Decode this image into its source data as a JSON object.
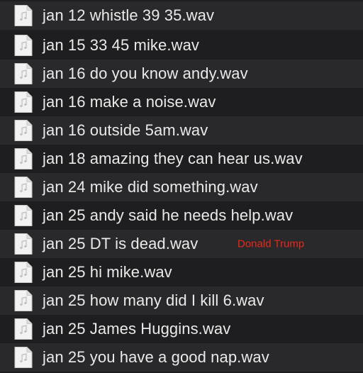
{
  "files": [
    {
      "name": "jan 12 whistle 39 35.wav",
      "icon": "audio-file-icon"
    },
    {
      "name": "jan 15 33 45 mike.wav",
      "icon": "audio-file-icon"
    },
    {
      "name": "jan 16 do you know andy.wav",
      "icon": "audio-file-icon"
    },
    {
      "name": "jan 16 make a noise.wav",
      "icon": "audio-file-icon"
    },
    {
      "name": "jan 16 outside 5am.wav",
      "icon": "audio-file-icon"
    },
    {
      "name": "jan 18 amazing they can hear us.wav",
      "icon": "audio-file-icon"
    },
    {
      "name": "jan 24 mike did something.wav",
      "icon": "audio-file-icon"
    },
    {
      "name": "jan 25 andy said he needs help.wav",
      "icon": "audio-file-icon"
    },
    {
      "name": "jan 25 DT is dead.wav",
      "icon": "audio-file-icon",
      "annotation": "Donald Trump"
    },
    {
      "name": "jan 25 hi mike.wav",
      "icon": "audio-file-icon"
    },
    {
      "name": "jan 25 how many did I kill 6.wav",
      "icon": "audio-file-icon"
    },
    {
      "name": "jan 25 James Huggins.wav",
      "icon": "audio-file-icon"
    },
    {
      "name": "jan 25 you have a good nap.wav",
      "icon": "audio-file-icon"
    }
  ],
  "colors": {
    "background": "#1e1e20",
    "stripe": "#29292c",
    "text": "#eaeaea",
    "annotation": "#e62a1a"
  }
}
